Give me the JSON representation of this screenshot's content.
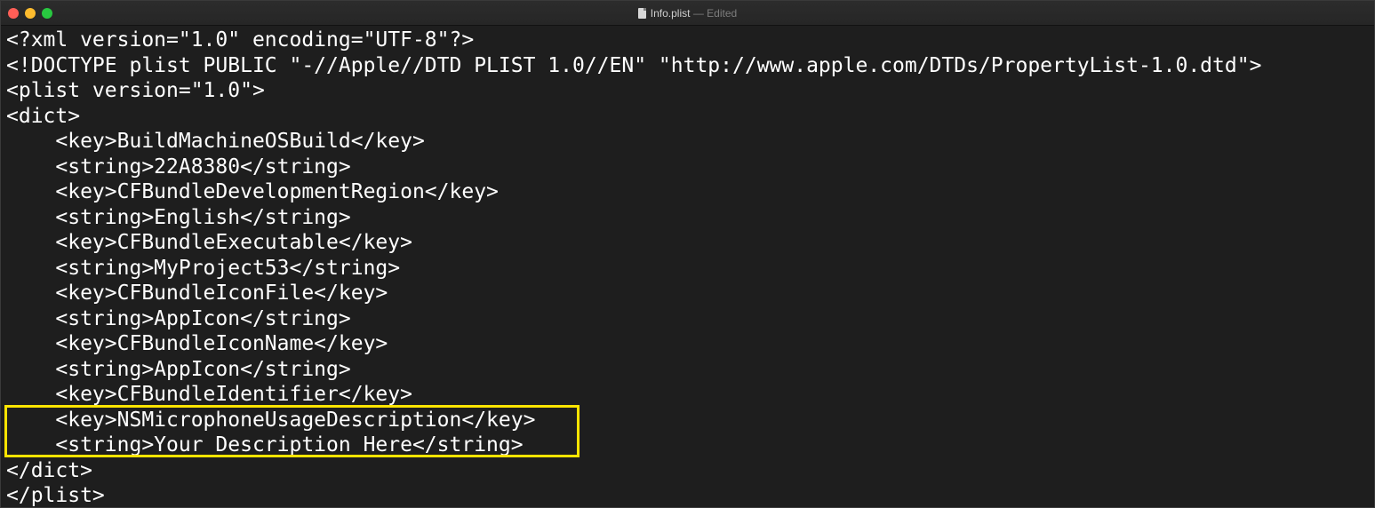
{
  "window": {
    "title": "Info.plist",
    "title_separator": "—",
    "status": "Edited"
  },
  "editor": {
    "lines": [
      "<?xml version=\"1.0\" encoding=\"UTF-8\"?>",
      "<!DOCTYPE plist PUBLIC \"-//Apple//DTD PLIST 1.0//EN\" \"http://www.apple.com/DTDs/PropertyList-1.0.dtd\">",
      "<plist version=\"1.0\">",
      "<dict>",
      "    <key>BuildMachineOSBuild</key>",
      "    <string>22A8380</string>",
      "    <key>CFBundleDevelopmentRegion</key>",
      "    <string>English</string>",
      "    <key>CFBundleExecutable</key>",
      "    <string>MyProject53</string>",
      "    <key>CFBundleIconFile</key>",
      "    <string>AppIcon</string>",
      "    <key>CFBundleIconName</key>",
      "    <string>AppIcon</string>",
      "    <key>CFBundleIdentifier</key>",
      "    <key>NSMicrophoneUsageDescription</key>",
      "    <string>Your Description Here</string>",
      "</dict>",
      "</plist>"
    ]
  },
  "colors": {
    "background": "#1e1e1e",
    "text": "#ffffff",
    "highlight_border": "#ffe400"
  }
}
